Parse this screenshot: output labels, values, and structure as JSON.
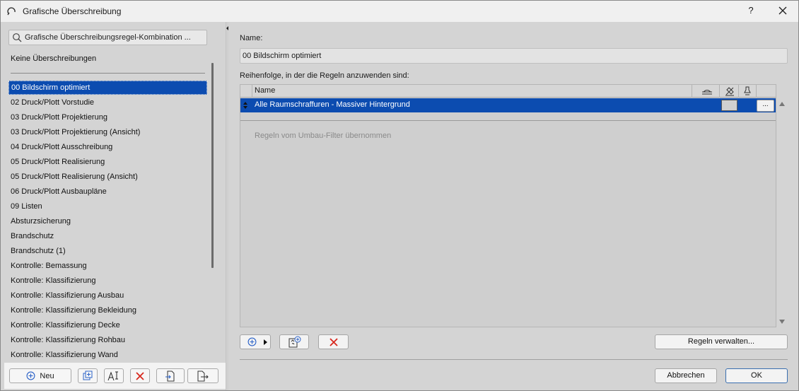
{
  "window": {
    "title": "Grafische Überschreibung",
    "help_label": "?"
  },
  "left": {
    "search_label": "Grafische Überschreibungsregel-Kombination ...",
    "none_item": "Keine Überschreibungen",
    "items": [
      "00 Bildschirm optimiert",
      "02 Druck/Plott Vorstudie",
      "03 Druck/Plott Projektierung",
      "03 Druck/Plott Projektierung (Ansicht)",
      "04 Druck/Plott Ausschreibung",
      "05 Druck/Plott Realisierung",
      "05 Druck/Plott Realisierung (Ansicht)",
      "06 Druck/Plott Ausbaupläne",
      "09 Listen",
      "Absturzsicherung",
      "Brandschutz",
      "Brandschutz (1)",
      "Kontrolle: Bemassung",
      "Kontrolle: Klassifizierung",
      "Kontrolle: Klassifizierung Ausbau",
      "Kontrolle: Klassifizierung Bekleidung",
      "Kontrolle: Klassifizierung Decke",
      "Kontrolle: Klassifizierung Rohbau",
      "Kontrolle: Klassifizierung Wand"
    ],
    "selected_index": 0,
    "new_button_label": "Neu"
  },
  "right": {
    "name_label": "Name:",
    "name_value": "00 Bildschirm optimiert",
    "order_label": "Reihenfolge, in der die Regeln anzuwenden sind:",
    "table": {
      "column_name": "Name",
      "rows": [
        {
          "name": "Alle Raumschraffuren - Massiver Hintergrund",
          "more_label": "..."
        }
      ],
      "inherited_note": "Regeln vom Umbau-Filter übernommen"
    },
    "manage_rules_label": "Regeln verwalten...",
    "cancel_label": "Abbrechen",
    "ok_label": "OK"
  },
  "colors": {
    "selection": "#0c4cb0",
    "delete_red": "#d8281e",
    "add_blue": "#2b62c8"
  }
}
